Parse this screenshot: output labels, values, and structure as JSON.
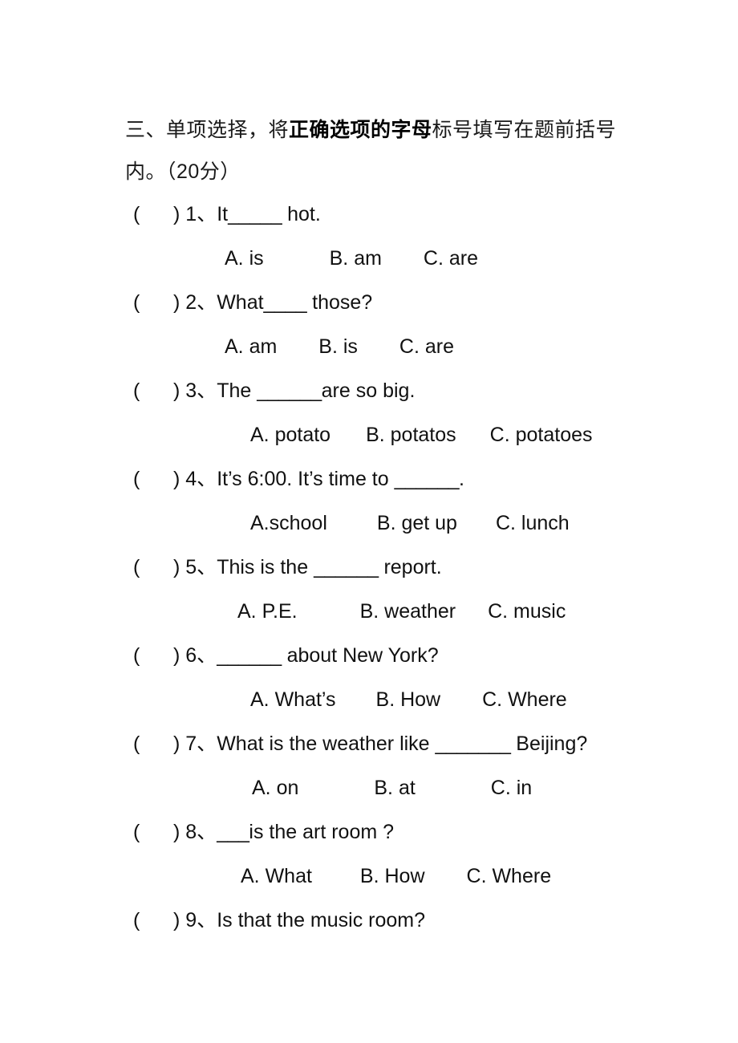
{
  "section": {
    "heading_prefix": "三、单项选择，将",
    "heading_emphasis": "正确选项的字母",
    "heading_suffix": "标号填写在题前括号",
    "heading_line2": "内。（20分）"
  },
  "questions": [
    {
      "bracket": "(      ) ",
      "number": "1、",
      "stem_before": "It",
      "blank": "_____",
      "stem_after": " hot.",
      "options_indent": 280,
      "options": [
        {
          "label": "A. is",
          "gap": 82
        },
        {
          "label": "B. am",
          "gap": 52
        },
        {
          "label": "C. are",
          "gap": 0
        }
      ]
    },
    {
      "bracket": "(      ) ",
      "number": "2、",
      "stem_before": "What",
      "blank": "____",
      "stem_after": " those?",
      "options_indent": 280,
      "options": [
        {
          "label": "A. am",
          "gap": 52
        },
        {
          "label": "B. is",
          "gap": 52
        },
        {
          "label": "C. are",
          "gap": 0
        }
      ]
    },
    {
      "bracket": "(      ) ",
      "number": "3、",
      "stem_before": "The ",
      "blank": "______",
      "stem_after": "are so big.",
      "options_indent": 312,
      "options": [
        {
          "label": "A. potato",
          "gap": 44
        },
        {
          "label": "B. potatos",
          "gap": 42
        },
        {
          "label": "C. potatoes",
          "gap": 0
        }
      ]
    },
    {
      "bracket": "(      ) ",
      "number": "4、",
      "stem_before": "It’s 6:00. It’s time to ",
      "blank": "______",
      "stem_after": ".",
      "options_indent": 312,
      "options": [
        {
          "label": "A.school",
          "gap": 62
        },
        {
          "label": "B. get up",
          "gap": 48
        },
        {
          "label": "C. lunch",
          "gap": 0
        }
      ]
    },
    {
      "bracket": "(      ) ",
      "number": "5、",
      "stem_before": "This is the ",
      "blank": "______",
      "stem_after": " report.",
      "options_indent": 296,
      "options": [
        {
          "label": "A. P.E.",
          "gap": 78
        },
        {
          "label": "B. weather",
          "gap": 40
        },
        {
          "label": "C. music",
          "gap": 0
        }
      ]
    },
    {
      "bracket": "(      ) ",
      "number": "6、",
      "stem_before": "",
      "blank": "______",
      "stem_after": " about New York?",
      "options_indent": 312,
      "options": [
        {
          "label": "A. What’s",
          "gap": 50
        },
        {
          "label": "B. How",
          "gap": 52
        },
        {
          "label": "C. Where",
          "gap": 0
        }
      ]
    },
    {
      "bracket": "(      ) ",
      "number": "7、",
      "stem_before": "What is the weather like ",
      "blank": "_______",
      "stem_after": " Beijing?",
      "options_indent": 314,
      "options": [
        {
          "label": "A. on",
          "gap": 94
        },
        {
          "label": "B. at",
          "gap": 94
        },
        {
          "label": "C. in",
          "gap": 0
        }
      ]
    },
    {
      "bracket": "(      ) ",
      "number": "8、",
      "stem_before": "",
      "blank": "___",
      "stem_after": "is the art room ?",
      "options_indent": 300,
      "options": [
        {
          "label": "A. What",
          "gap": 60
        },
        {
          "label": "B. How",
          "gap": 52
        },
        {
          "label": "C. Where",
          "gap": 0
        }
      ]
    },
    {
      "bracket": "(      ) ",
      "number": "9、",
      "stem_before": "Is that the music room?",
      "blank": "",
      "stem_after": "",
      "options_indent": 0,
      "options": []
    }
  ]
}
